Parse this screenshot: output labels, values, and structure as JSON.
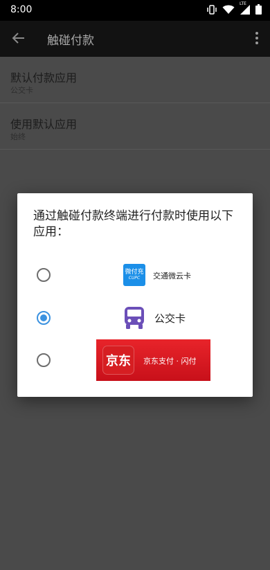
{
  "status_bar": {
    "time": "8:00",
    "network": "LTE"
  },
  "app_bar": {
    "title": "触碰付款"
  },
  "settings": [
    {
      "title": "默认付款应用",
      "subtitle": "公交卡"
    },
    {
      "title": "使用默认应用",
      "subtitle": "始终"
    }
  ],
  "dialog": {
    "title": "通过触碰付款终端进行付款时使用以下应用：",
    "options": [
      {
        "logo_text": "微付充",
        "logo_sub": "CUPC",
        "label": "交通微云卡",
        "selected": false,
        "logo_color": "#1b8fe8"
      },
      {
        "label": "公交卡",
        "selected": true,
        "icon": "bus-icon",
        "icon_color": "#6b4fb8"
      },
      {
        "logo_text": "京东",
        "label": "京东支付 · 闪付",
        "selected": false,
        "banner_color": "#d9171f"
      }
    ]
  },
  "colors": {
    "accent": "#3b92e0",
    "scrim": "#4a4a4a"
  }
}
